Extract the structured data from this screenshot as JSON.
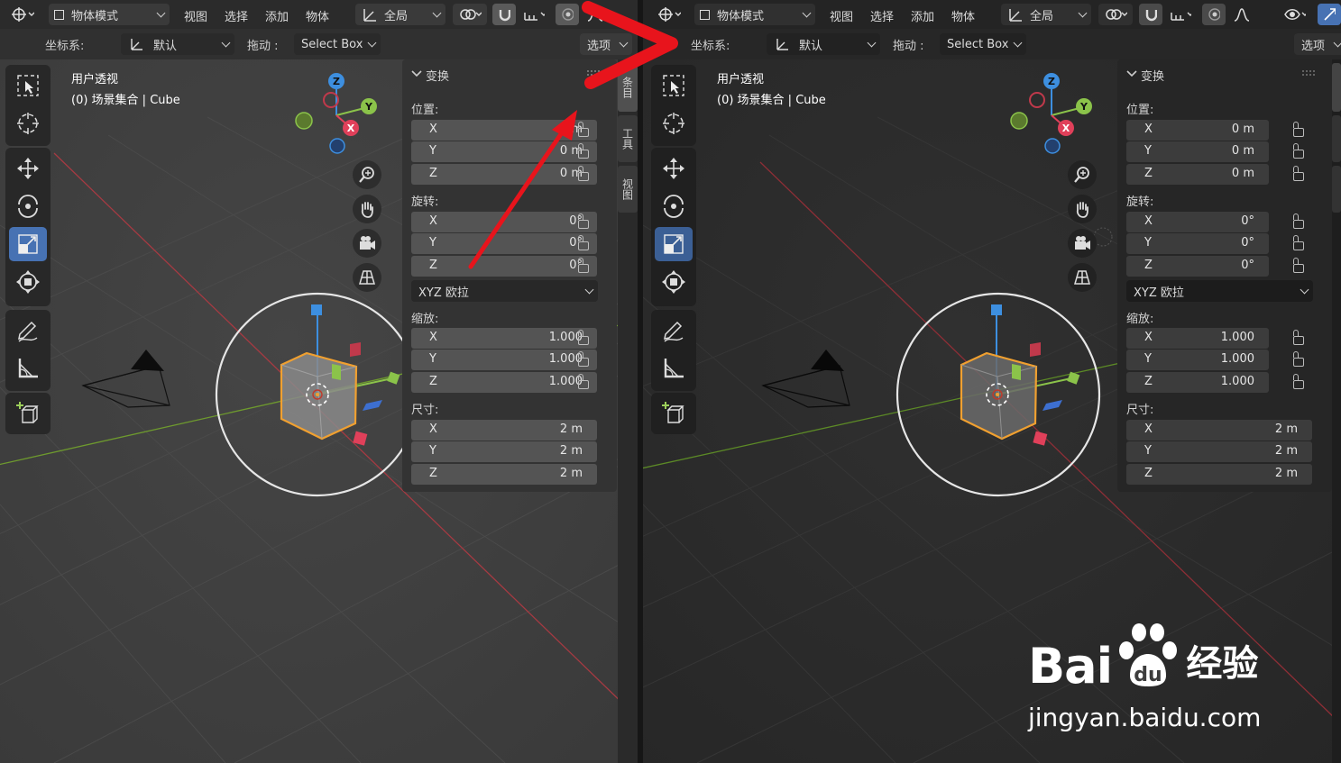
{
  "header": {
    "mode": "物体模式",
    "menus": [
      "视图",
      "选择",
      "添加",
      "物体"
    ],
    "transform_orientation": "全局"
  },
  "tool_settings": {
    "coord_label": "坐标系:",
    "coord_value": "默认",
    "drag_label": "拖动 :",
    "drag_value": "Select Box",
    "options_label": "选项"
  },
  "viewport": {
    "view_name": "用户透视",
    "object_info": "(0) 场景集合 | Cube"
  },
  "gizmo": {
    "x": "X",
    "y": "Y",
    "z": "Z"
  },
  "sidebar_tabs": [
    "条目",
    "工具",
    "视图"
  ],
  "npanel": {
    "title": "变换",
    "location_label": "位置:",
    "location": [
      {
        "axis": "X",
        "value": "0 m"
      },
      {
        "axis": "Y",
        "value": "0 m"
      },
      {
        "axis": "Z",
        "value": "0 m"
      }
    ],
    "rotation_label": "旋转:",
    "rotation": [
      {
        "axis": "X",
        "value": "0°"
      },
      {
        "axis": "Y",
        "value": "0°"
      },
      {
        "axis": "Z",
        "value": "0°"
      }
    ],
    "rotation_mode": "XYZ 欧拉",
    "scale_label": "缩放:",
    "scale": [
      {
        "axis": "X",
        "value": "1.000"
      },
      {
        "axis": "Y",
        "value": "1.000"
      },
      {
        "axis": "Z",
        "value": "1.000"
      }
    ],
    "dimensions_label": "尺寸:",
    "dimensions": [
      {
        "axis": "X",
        "value": "2 m"
      },
      {
        "axis": "Y",
        "value": "2 m"
      },
      {
        "axis": "Z",
        "value": "2 m"
      }
    ]
  },
  "watermark": {
    "brand": "Bai",
    "du": "du",
    "cn": "经验",
    "url": "jingyan.baidu.com"
  },
  "colors": {
    "accent": "#4772b3",
    "annotation": "#e8141c",
    "x_axis": "#e0405a",
    "y_axis": "#8bc34a",
    "z_axis": "#3d8fe0"
  }
}
